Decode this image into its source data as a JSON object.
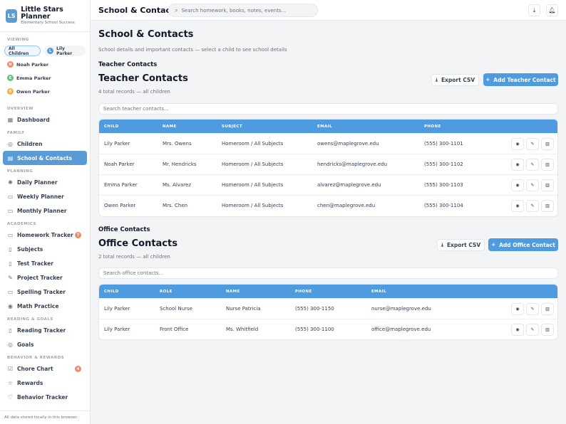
{
  "app": {
    "logo_initials": "LS",
    "title": "Little Stars Planner",
    "subtitle": "Elementary School Success",
    "footer": "All data stored locally in this browser."
  },
  "viewing": {
    "label": "VIEWING",
    "chips": [
      {
        "label": "All Children",
        "active": true
      },
      {
        "label": "Lily Parker",
        "initial": "L",
        "color": "#5b9bd5"
      }
    ],
    "children": [
      {
        "label": "Noah Parker",
        "initial": "N",
        "color": "#f28b6b"
      },
      {
        "label": "Emma Parker",
        "initial": "E",
        "color": "#6bbf8a"
      },
      {
        "label": "Owen Parker",
        "initial": "O",
        "color": "#f0b04a"
      }
    ]
  },
  "nav": {
    "overview_label": "OVERVIEW",
    "family_label": "FAMILY",
    "planning_label": "PLANNING",
    "academics_label": "ACADEMICS",
    "reading_label": "READING & GOALS",
    "behavior_label": "BEHAVIOR & REWARDS",
    "dashboard": "Dashboard",
    "children": "Children",
    "school_contacts": "School & Contacts",
    "daily": "Daily Planner",
    "weekly": "Weekly Planner",
    "monthly": "Monthly Planner",
    "homework": "Homework Tracker",
    "homework_badge": "7",
    "subjects": "Subjects",
    "test": "Test Tracker",
    "project": "Project Tracker",
    "spelling": "Spelling Tracker",
    "math": "Math Practice",
    "reading_tracker": "Reading Tracker",
    "goals": "Goals",
    "chore": "Chore Chart",
    "chore_badge": "4",
    "rewards": "Rewards",
    "behavior": "Behavior Tracker"
  },
  "topbar": {
    "title": "School & Contacts",
    "search_placeholder": "Search homework, books, notes, events..."
  },
  "page": {
    "title": "School & Contacts",
    "subtitle": "School details and important contacts — select a child to see school details"
  },
  "teachers": {
    "section_label": "Teacher Contacts",
    "title": "Teacher Contacts",
    "meta": "4 total records — all children",
    "export_label": "Export CSV",
    "add_label": "Add Teacher Contact",
    "search_placeholder": "Search teacher contacts...",
    "columns": [
      "CHILD",
      "NAME",
      "SUBJECT",
      "EMAIL",
      "PHONE"
    ],
    "rows": [
      [
        "Lily Parker",
        "Mrs. Owens",
        "Homeroom / All Subjects",
        "owens@maplegrove.edu",
        "(555) 300-1101"
      ],
      [
        "Noah Parker",
        "Mr. Hendricks",
        "Homeroom / All Subjects",
        "hendricks@maplegrove.edu",
        "(555) 300-1102"
      ],
      [
        "Emma Parker",
        "Ms. Alvarez",
        "Homeroom / All Subjects",
        "alvarez@maplegrove.edu",
        "(555) 300-1103"
      ],
      [
        "Owen Parker",
        "Mrs. Chen",
        "Homeroom / All Subjects",
        "chen@maplegrove.edu",
        "(555) 300-1104"
      ]
    ]
  },
  "office": {
    "section_label": "Office Contacts",
    "title": "Office Contacts",
    "meta": "2 total records — all children",
    "export_label": "Export CSV",
    "add_label": "Add Office Contact",
    "search_placeholder": "Search office contacts...",
    "columns": [
      "CHILD",
      "ROLE",
      "NAME",
      "PHONE",
      "EMAIL"
    ],
    "rows": [
      [
        "Lily Parker",
        "School Nurse",
        "Nurse Patricia",
        "(555) 300-1150",
        "nurse@maplegrove.edu"
      ],
      [
        "Lily Parker",
        "Front Office",
        "Ms. Whitfield",
        "(555) 300-1100",
        "office@maplegrove.edu"
      ]
    ]
  }
}
